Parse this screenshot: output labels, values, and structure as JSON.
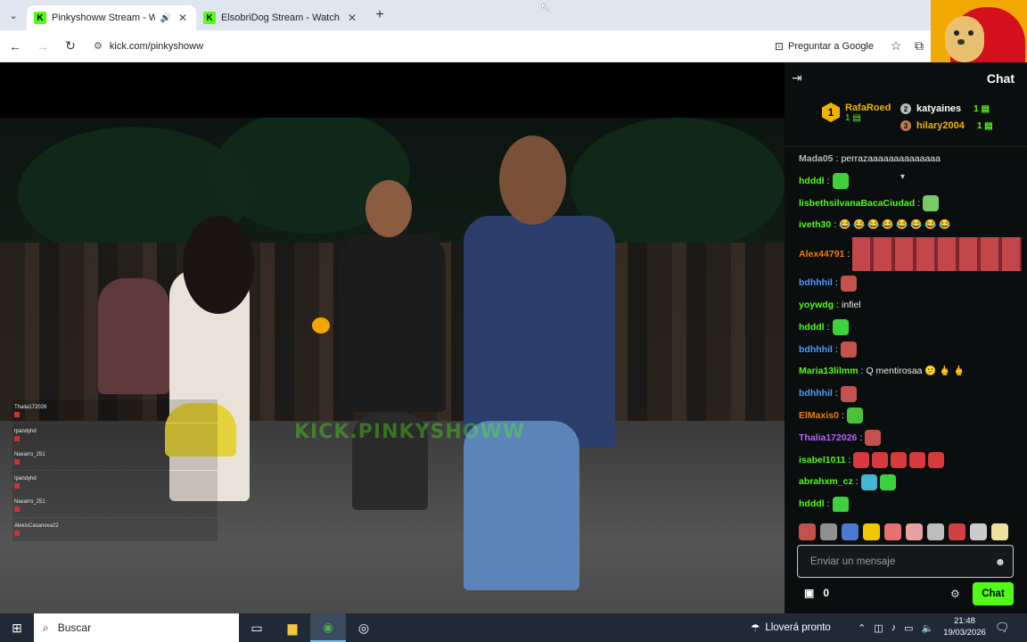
{
  "browser": {
    "tabs": [
      {
        "title": "Pinkyshoww Stream - Watch",
        "active": true
      },
      {
        "title": "ElsobriDog Stream - Watch Live",
        "active": false
      }
    ],
    "url": "kick.com/pinkyshoww",
    "google_button": "Preguntar a Google"
  },
  "video": {
    "watermark": "KICK.PINKYSHOWW",
    "overlay_chat": [
      {
        "name": "Thalia172026"
      },
      {
        "name": "tpandyhd"
      },
      {
        "name": "Navarro_251"
      },
      {
        "name": "tpandyhd"
      },
      {
        "name": "Navarro_251"
      },
      {
        "name": "AlexisCasanova22"
      }
    ]
  },
  "chat": {
    "title": "Chat",
    "leaderboard": {
      "first": {
        "rank": "1",
        "name": "RafaRoed",
        "count": "1"
      },
      "second": {
        "rank": "2",
        "name": "katyaines",
        "count": "1"
      },
      "third": {
        "rank": "3",
        "name": "hilary2004",
        "count": "1"
      }
    },
    "messages": [
      {
        "user": "Mada05",
        "color": "#b9b9b9",
        "text": "perrazaaaaaaaaaaaaaa"
      },
      {
        "user": "hdddl",
        "color": "#53fc18",
        "text": "",
        "emote": "#3fd13b"
      },
      {
        "user": "lisbethsilvanaBacaCiudad",
        "color": "#53fc18",
        "text": "",
        "emote": "#79c96b"
      },
      {
        "user": "iveth30",
        "color": "#53fc18",
        "text": "😂 😂 😂 😂 😂 😂 😂 😂"
      },
      {
        "user": "Alex44791",
        "color": "#f57c00",
        "text": "",
        "emote_grid": true
      },
      {
        "user": "bdhhhil",
        "color": "#4f9bff",
        "text": "",
        "emote": "#c3524e"
      },
      {
        "user": "yoywdg",
        "color": "#53fc18",
        "text": "infiel"
      },
      {
        "user": "hdddl",
        "color": "#53fc18",
        "text": "",
        "emote": "#3fd13b"
      },
      {
        "user": "bdhhhil",
        "color": "#4f9bff",
        "text": "",
        "emote": "#c3524e"
      },
      {
        "user": "Maria13lilmm",
        "color": "#53fc18",
        "text": "Q mentirosaa 😕 🖕 🖕"
      },
      {
        "user": "bdhhhil",
        "color": "#4f9bff",
        "text": "",
        "emote": "#c3524e"
      },
      {
        "user": "ElMaxis0",
        "color": "#f57c00",
        "text": "",
        "emote": "#49c13a"
      },
      {
        "user": "Thalia172026",
        "color": "#b664ff",
        "text": "",
        "emote": "#c3524e"
      },
      {
        "user": "isabel1011",
        "color": "#53fc18",
        "text": "",
        "emote": "#d8393b",
        "emote_count": 5
      },
      {
        "user": "abrahxm_cz",
        "color": "#53fc18",
        "text": "",
        "emote": "#45b5d8",
        "emote2": "#3fd13b"
      },
      {
        "user": "hdddl",
        "color": "#53fc18",
        "text": "",
        "emote": "#3fd13b"
      }
    ],
    "emote_bar": [
      "#c3524e",
      "#8f8f8f",
      "#4a7ad0",
      "#f0c800",
      "#e87070",
      "#e9a0a0",
      "#bdbdbd",
      "#d04040",
      "#cccccc",
      "#f0e0a0"
    ],
    "input_placeholder": "Enviar un mensaje",
    "points": "0",
    "send_label": "Chat"
  },
  "taskbar": {
    "search_label": "Buscar",
    "weather": "Lloverá pronto",
    "time": "21:48",
    "date": "19/03/2026"
  }
}
